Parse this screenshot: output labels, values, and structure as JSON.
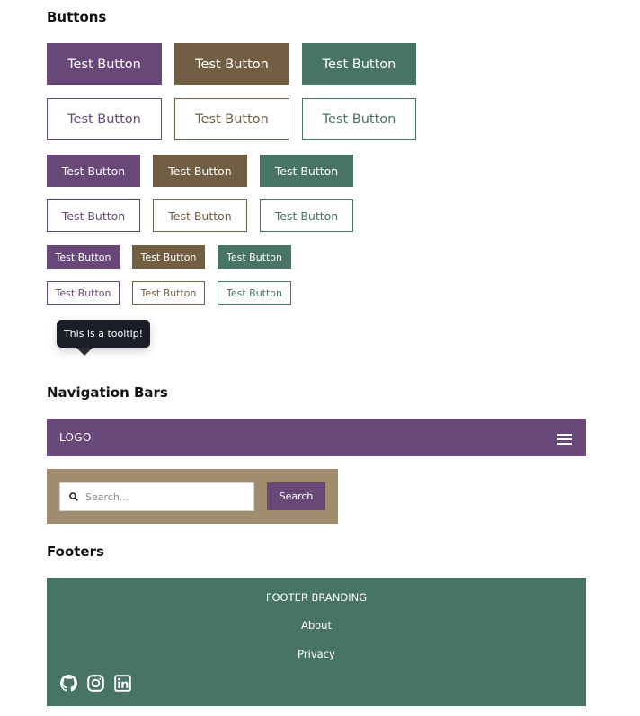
{
  "colors": {
    "purple": "#684879",
    "brown": "#725e42",
    "green": "#487563",
    "tan": "#a18d6d",
    "tooltip_bg": "#1b1e29"
  },
  "sections": {
    "buttons_title": "Buttons",
    "nav_title": "Navigation Bars",
    "footer_title": "Footers"
  },
  "buttons": {
    "label": "Test Button"
  },
  "tooltip": {
    "text": "This is a tooltip!"
  },
  "navbar": {
    "logo": "LOGO",
    "menu_icon": "hamburger-menu-icon"
  },
  "search": {
    "placeholder": "Search...",
    "value": "",
    "button_label": "Search",
    "icon": "search-icon"
  },
  "footer": {
    "branding": "FOOTER BRANDING",
    "links": [
      "About",
      "Privacy"
    ],
    "social_icons": [
      "github-icon",
      "instagram-icon",
      "linkedin-icon"
    ]
  }
}
